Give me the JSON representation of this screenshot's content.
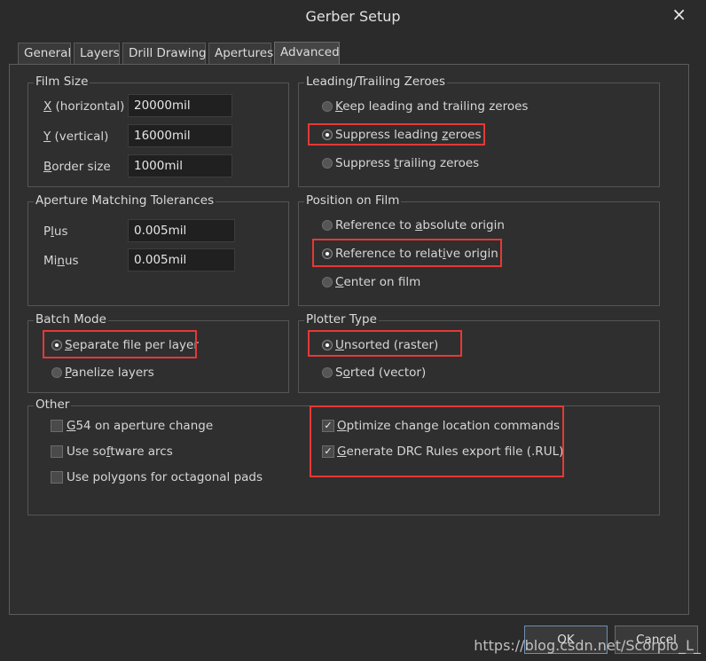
{
  "window": {
    "title": "Gerber Setup",
    "close_icon": "×"
  },
  "tabs": [
    {
      "label": "General"
    },
    {
      "label": "Layers"
    },
    {
      "label": "Drill Drawing"
    },
    {
      "label": "Apertures"
    },
    {
      "label": "Advanced",
      "active": true
    }
  ],
  "film_size": {
    "title": "Film Size",
    "x_label_key": "X",
    "x_label_rest": " (horizontal)",
    "x_value": "20000mil",
    "y_label_key": "Y",
    "y_label_rest": " (vertical)",
    "y_value": "16000mil",
    "border_label_key": "B",
    "border_label_rest": "order size",
    "border_value": "1000mil"
  },
  "aperture_tolerances": {
    "title": "Aperture Matching Tolerances",
    "plus_label_a": "P",
    "plus_label_key": "l",
    "plus_label_rest": "us",
    "plus_value": "0.005mil",
    "minus_label_a": "Mi",
    "minus_label_key": "n",
    "minus_label_rest": "us",
    "minus_value": "0.005mil"
  },
  "batch_mode": {
    "title": "Batch Mode",
    "separate_key": "S",
    "separate_rest": "eparate file per layer",
    "panelize_key": "P",
    "panelize_rest": "anelize layers"
  },
  "leading_trailing": {
    "title": "Leading/Trailing Zeroes",
    "keep_key": "K",
    "keep_rest": "eep leading and trailing zeroes",
    "suppress_leading_a": "Suppress leading ",
    "suppress_leading_key": "z",
    "suppress_leading_rest": "eroes",
    "suppress_trailing_a": "Suppress ",
    "suppress_trailing_key": "t",
    "suppress_trailing_rest": "railing zeroes"
  },
  "position_on_film": {
    "title": "Position on Film",
    "abs_a": "Reference to ",
    "abs_key": "a",
    "abs_rest": "bsolute origin",
    "rel_a": "Reference to relat",
    "rel_key": "i",
    "rel_rest": "ve origin",
    "center_key": "C",
    "center_rest": "enter on film"
  },
  "plotter_type": {
    "title": "Plotter Type",
    "unsorted_key": "U",
    "unsorted_rest": "nsorted (raster)",
    "sorted_a": "S",
    "sorted_key": "o",
    "sorted_rest": "rted (vector)"
  },
  "other": {
    "title": "Other",
    "g54_key": "G",
    "g54_rest": "54 on aperture change",
    "soft_a": "Use so",
    "soft_key": "f",
    "soft_rest": "tware arcs",
    "poly_a": "Use polygons for octagonal pads",
    "optimize_key": "O",
    "optimize_rest": "ptimize change location commands",
    "drc_key": "G",
    "drc_rest": "enerate DRC Rules export file (.RUL)",
    "check_glyph": "✓"
  },
  "buttons": {
    "ok": "OK",
    "cancel": "Cancel"
  },
  "watermark": "https://blog.csdn.net/Scorpio_L_",
  "colors": {
    "highlight": "#e53935",
    "background": "#2b2b2b"
  }
}
